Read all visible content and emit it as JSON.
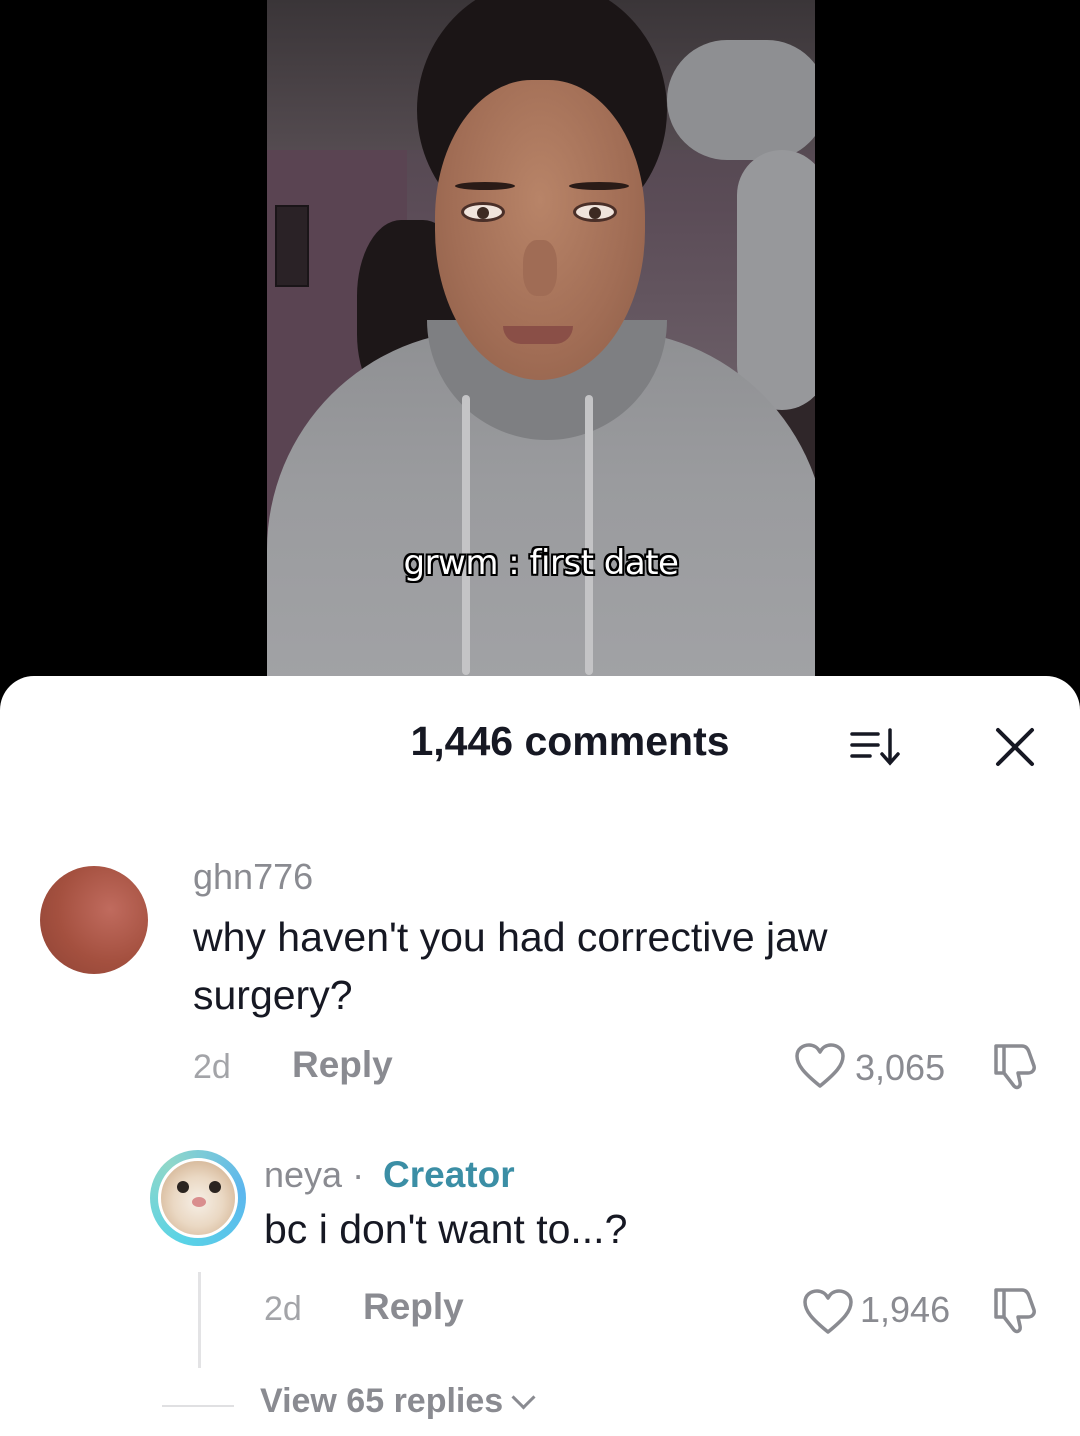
{
  "video": {
    "caption": "grwm : first date"
  },
  "comments_sheet": {
    "count_label": "1,446 comments",
    "sort_icon": "sort-icon",
    "close_icon": "close-icon"
  },
  "comments": [
    {
      "username": "ghn776",
      "text": "why haven't you had corrective jaw surgery?",
      "time": "2d",
      "reply_label": "Reply",
      "likes": "3,065",
      "avatar_color": "#a4503f"
    },
    {
      "username": "neya",
      "separator": "·",
      "badge": "Creator",
      "text": "bc i don't want to...?",
      "time": "2d",
      "reply_label": "Reply",
      "likes": "1,946",
      "badge_color": "#3b8ea5"
    }
  ],
  "view_replies_label": "View 65 replies"
}
